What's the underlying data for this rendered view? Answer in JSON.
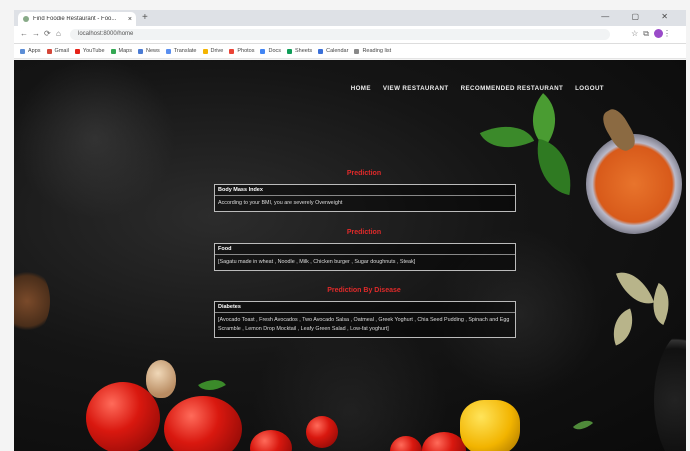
{
  "browser": {
    "tab_title": "Find Foodie Restaurant - Foo...",
    "tab_close": "×",
    "new_tab": "+",
    "window_controls": "— ▢ ✕",
    "address": "localhost:8000/home",
    "back": "←",
    "forward": "→",
    "reload": "⟳",
    "home": "⌂",
    "bookmarks": [
      {
        "label": "Apps",
        "color": "#5b8dd6"
      },
      {
        "label": "Gmail",
        "color": "#d44638"
      },
      {
        "label": "YouTube",
        "color": "#e62117"
      },
      {
        "label": "Maps",
        "color": "#34a853"
      },
      {
        "label": "News",
        "color": "#4a7bd4"
      },
      {
        "label": "Translate",
        "color": "#5a8ff0"
      },
      {
        "label": "Drive",
        "color": "#f4b400"
      },
      {
        "label": "Photos",
        "color": "#ea4335"
      },
      {
        "label": "Docs",
        "color": "#4285f4"
      },
      {
        "label": "Sheets",
        "color": "#0f9d58"
      },
      {
        "label": "Calendar",
        "color": "#3a6fd8"
      },
      {
        "label": "Reading list",
        "color": "#888888"
      }
    ]
  },
  "nav": {
    "items": [
      "HOME",
      "VIEW RESTAURANT",
      "RECOMMENDED RESTAURANT",
      "LOGOUT"
    ]
  },
  "sections": [
    {
      "title": "Prediction",
      "header": "Body Mass Index",
      "body": "According to your BMI, you are severely Overweight"
    },
    {
      "title": "Prediction",
      "header": "Food",
      "body": "[Sagatu made in wheat , Noodle , Milk , Chicken burger , Sugar doughnuts , Steak]"
    },
    {
      "title": "Prediction By Disease",
      "header": "Diabetes",
      "body": "[Avocado Toast , Fresh Avocados , Two Avocado Salsa , Oatmeal , Greek Yoghurt , Chia Seed Pudding , Spinach and Egg Scramble , Lemon Drop Mocktail , Leafy Green Salad , Low-fat yoghurt]"
    }
  ],
  "colors": {
    "accent_red": "#e02a2a",
    "background": "#111111"
  }
}
